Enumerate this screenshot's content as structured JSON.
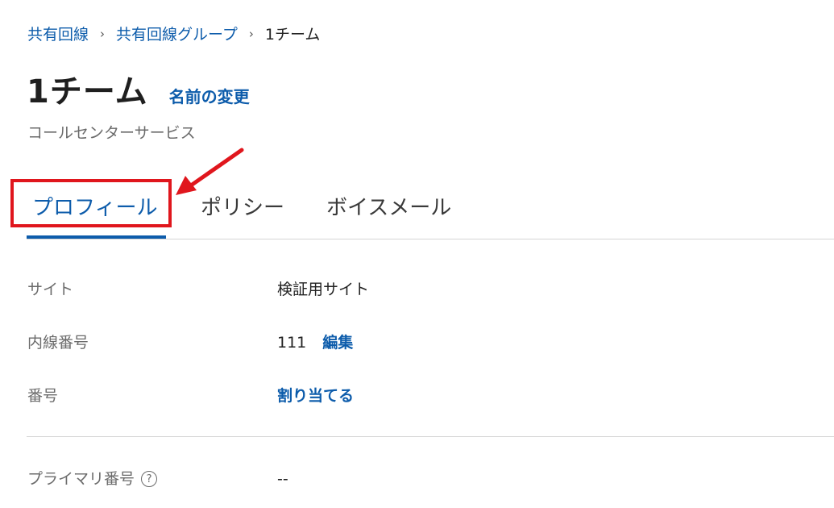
{
  "breadcrumb": {
    "items": [
      "共有回線",
      "共有回線グループ"
    ],
    "current": "1チーム",
    "separator": "›"
  },
  "header": {
    "title": "1チーム",
    "rename_label": "名前の変更",
    "subtitle": "コールセンターサービス"
  },
  "tabs": [
    {
      "label": "プロフィール",
      "active": true
    },
    {
      "label": "ポリシー",
      "active": false
    },
    {
      "label": "ボイスメール",
      "active": false
    }
  ],
  "profile": {
    "site": {
      "label": "サイト",
      "value": "検証用サイト"
    },
    "extension": {
      "label": "内線番号",
      "value": "111",
      "edit_label": "編集"
    },
    "number": {
      "label": "番号",
      "action_label": "割り当てる"
    },
    "primary_number": {
      "label": "プライマリ番号",
      "help_icon": "?",
      "value": "--"
    }
  },
  "colors": {
    "link": "#0d5cab",
    "annotation": "#e0161d"
  }
}
